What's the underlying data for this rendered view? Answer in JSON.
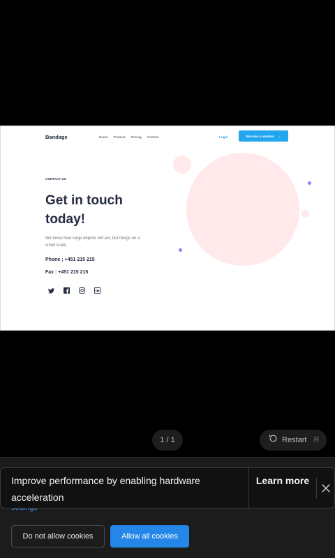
{
  "preview": {
    "brand": "Bandage",
    "nav": [
      "Home",
      "Product",
      "Pricing",
      "Contact"
    ],
    "login": "Login",
    "member_button": "Become a member",
    "member_arrow": "→",
    "eyebrow": "CONTACT US",
    "headline": "Get in touch today!",
    "description": "We know how large objects will act, but things on a small scale",
    "phone": "Phone ; +451 215 215",
    "fax": "Fax : +451 215 215",
    "social_icons": [
      "twitter-icon",
      "facebook-icon",
      "instagram-icon",
      "linkedin-icon"
    ],
    "colors": {
      "primary": "#23a6f0",
      "heading": "#252b42",
      "muted": "#737373",
      "pink": "#ffe9ea",
      "violet": "#977df4"
    }
  },
  "viewer": {
    "page_counter": "1 / 1",
    "restart_label": "Restart",
    "restart_key": "R"
  },
  "toast": {
    "message": "Improve performance by enabling hardware acceleration",
    "learn_more": "Learn more"
  },
  "cookies": {
    "settings_link": "settings",
    "deny_label": "Do not allow cookies",
    "allow_label": "Allow all cookies",
    "accent": "#2486e7"
  }
}
